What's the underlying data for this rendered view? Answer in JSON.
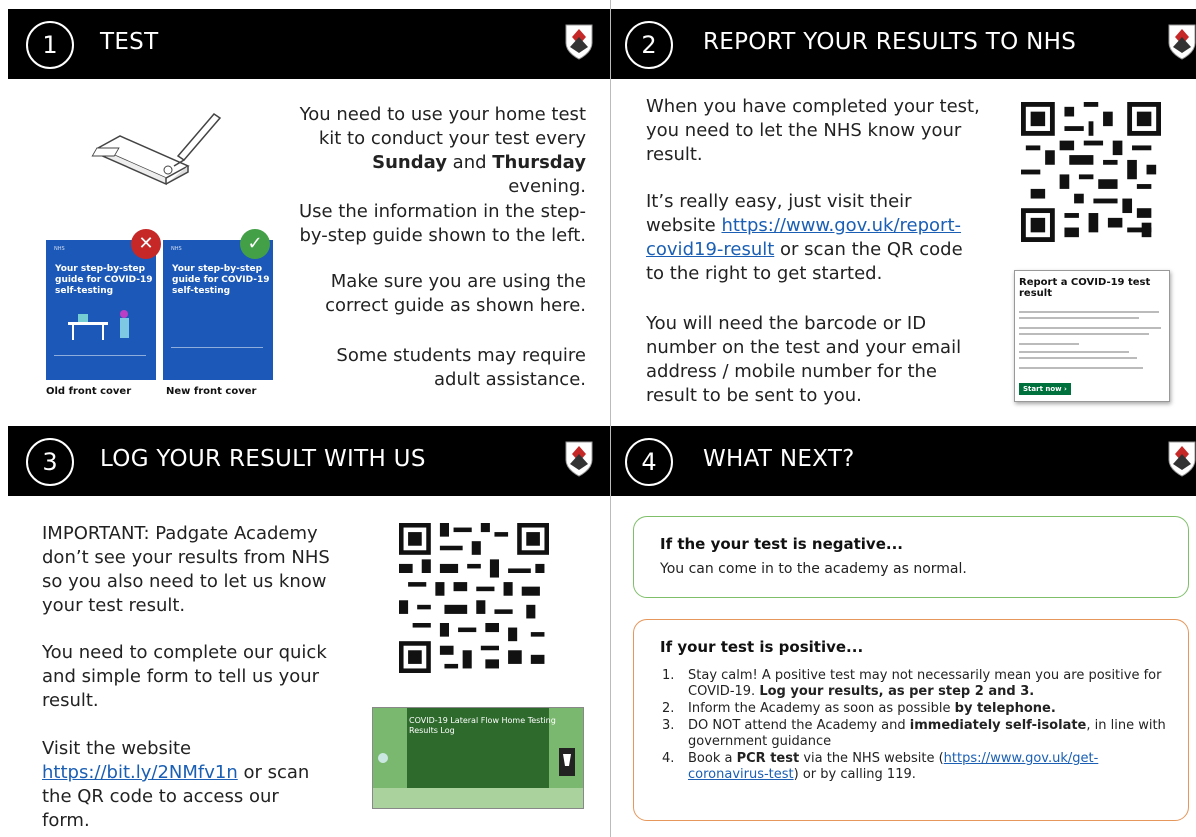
{
  "q1": {
    "num": "1",
    "title": "TEST",
    "p1_a": "You need to use your home test kit to conduct your test every",
    "p1_sunday": "Sunday",
    "p1_and": "and",
    "p1_thursday": "Thursday",
    "p1_evening": "evening.",
    "p2": "Use the information in the step-by-step guide shown to the left.",
    "p3": "Make sure you are using the correct guide as shown here.",
    "p4": "Some students may require adult assistance.",
    "old_cover_title": "Your step-by-step guide for COVID-19 self-testing",
    "new_cover_title": "Your step-by-step guide for COVID-19 self-testing",
    "old_caption": "Old front cover",
    "new_caption": "New front cover",
    "reject_mark": "✕",
    "accept_mark": "✓",
    "badge_colors": {
      "reject": "#c62828",
      "accept": "#43a047"
    }
  },
  "q2": {
    "num": "2",
    "title": "REPORT YOUR RESULTS TO NHS",
    "p1": "When you have completed your test, you need to let the NHS know your result.",
    "p2_a": "It’s really easy, just visit their website",
    "p2_link": "https://www.gov.uk/report-covid19-result",
    "p2_b": "or scan the QR code to the right to get started.",
    "p3": "You will need the barcode or ID number on the test and your email address / mobile number for the result to be sent to you.",
    "card_title": "Report a COVID-19 test result",
    "card_button": "Start now ›"
  },
  "q3": {
    "num": "3",
    "title": "LOG YOUR RESULT WITH US",
    "p1": "IMPORTANT: Padgate Academy don’t see your results from NHS so you also need to let us know your test result.",
    "p2": "You need to complete our quick and simple form to tell us your result.",
    "p3_a": "Visit the website",
    "p3_link": "https://bit.ly/2NMfv1n",
    "p3_b": "or scan the QR code to access our form.",
    "card_title": "COVID-19 Lateral Flow Home Testing Results Log"
  },
  "q4": {
    "num": "4",
    "title": "WHAT NEXT?",
    "neg_heading": "If the your test is negative...",
    "neg_text": "You can come in to the academy as normal.",
    "pos_heading": "If your test is positive...",
    "items": [
      {
        "n": "1.",
        "a": "Stay calm!  A positive test may not necessarily mean you are positive for COVID-19.  ",
        "b": "Log your results, as per step 2 and 3.",
        "c": ""
      },
      {
        "n": "2.",
        "a": "Inform the Academy as soon as possible ",
        "b": "by telephone.",
        "c": ""
      },
      {
        "n": "3.",
        "a": "DO NOT attend the Academy and ",
        "b": "immediately self-isolate",
        "c": ", in line with government guidance"
      },
      {
        "n": "4.",
        "a": "Book a ",
        "b": "PCR test",
        "c": " via the NHS website ("
      }
    ],
    "item4_link": "https://www.gov.uk/get-coronavirus-test",
    "item4_tail": ") or by calling 119."
  },
  "colors": {
    "header": "#000000",
    "link": "#1a5fb4",
    "negative_border": "#7fbf6a",
    "positive_border": "#e5975c"
  }
}
